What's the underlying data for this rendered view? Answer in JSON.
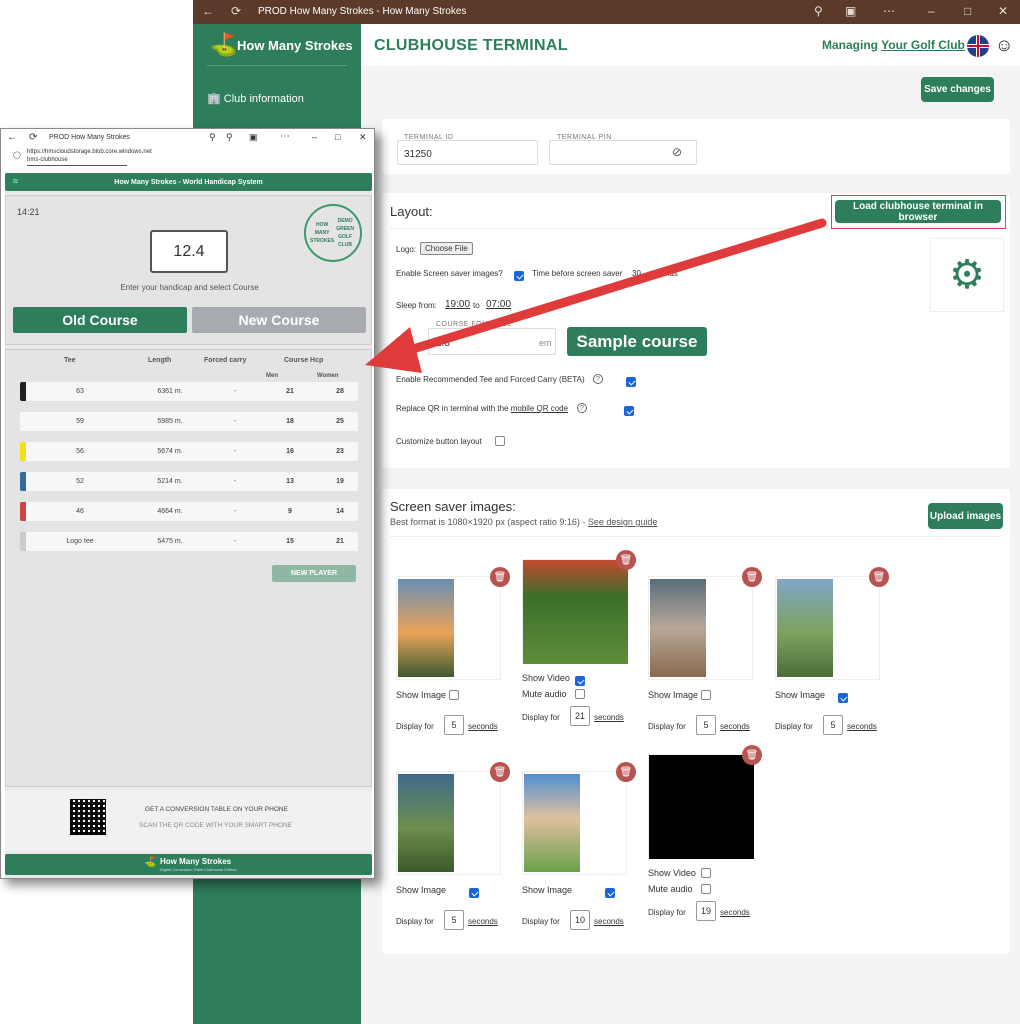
{
  "window": {
    "title": "PROD How Many Strokes - How Many Strokes"
  },
  "sidebar": {
    "brand": "How Many Strokes",
    "items": [
      {
        "label": "Club information"
      }
    ]
  },
  "header": {
    "title": "CLUBHOUSE TERMINAL",
    "managing_prefix": "Managing ",
    "club_name": "Your Golf Club"
  },
  "toolbar": {
    "save_label": "Save changes"
  },
  "terminal": {
    "id_label": "TERMINAL ID",
    "id_value": "31250",
    "pin_label": "TERMINAL PIN"
  },
  "layout": {
    "title": "Layout:",
    "load_button": "Load clubhouse terminal in browser",
    "logo_label": "Logo:",
    "choose_file": "Choose File",
    "screen_saver_label": "Enable Screen saver images?",
    "time_before_label": "Time before screen saver",
    "time_before_value": "30",
    "time_before_unit": "seconds",
    "sleep_from_label": "Sleep from:",
    "sleep_from": "19:00",
    "sleep_to_label": "to",
    "sleep_to": "07:00",
    "font_size_label": "COURSE FONT SIZE",
    "font_size_value": "1.8",
    "font_size_unit": "em",
    "recommended_label": "Enable Recommended Tee and Forced Carry (BETA)",
    "replace_qr_prefix": "Replace QR in terminal with the ",
    "replace_qr_link": "mobile QR code",
    "customize_label": "Customize button layout",
    "sample_badge": "Sample course"
  },
  "screensaver": {
    "title": "Screen saver images:",
    "subtitle": "Best format is 1080×1920 px (aspect ratio 9:16) - ",
    "guide_link": "See design guide",
    "upload_button": "Upload images",
    "display_for": "Display for",
    "seconds": "seconds",
    "show_image": "Show Image",
    "show_video": "Show Video",
    "mute_audio": "Mute audio",
    "items": [
      {
        "kind": "image",
        "show": false,
        "seconds": "5"
      },
      {
        "kind": "video",
        "show": true,
        "mute": false,
        "seconds": "21"
      },
      {
        "kind": "image",
        "show": false,
        "seconds": "5"
      },
      {
        "kind": "image",
        "show": true,
        "seconds": "5"
      },
      {
        "kind": "image",
        "show": true,
        "seconds": "5"
      },
      {
        "kind": "image",
        "show": true,
        "seconds": "10"
      },
      {
        "kind": "video",
        "show": false,
        "mute": false,
        "seconds": "19"
      }
    ]
  },
  "overlay": {
    "title": "PROD How Many Strokes",
    "url1": "https://hmscloudstorage.blob.core.windows.net",
    "url2": "hms-clubhouse",
    "app_title": "How Many Strokes - World Handicap System",
    "time": "14:21",
    "handicap": "12.4",
    "prompt": "Enter your handicap and select Course",
    "old_course": "Old Course",
    "new_course": "New Course",
    "headers": {
      "tee": "Tee",
      "length": "Length",
      "forced": "Forced carry",
      "hcp": "Course Hcp",
      "men": "Men",
      "women": "Women"
    },
    "rows": [
      {
        "tee": "63",
        "length": "6361 m.",
        "forced": "-",
        "men": "21",
        "women": "28",
        "color": "#222222"
      },
      {
        "tee": "59",
        "length": "5985 m.",
        "forced": "-",
        "men": "18",
        "women": "25",
        "color": "#f7f7f7"
      },
      {
        "tee": "56",
        "length": "5674 m.",
        "forced": "-",
        "men": "16",
        "women": "23",
        "color": "#f2e11a"
      },
      {
        "tee": "52",
        "length": "5214 m.",
        "forced": "-",
        "men": "13",
        "women": "19",
        "color": "#2f6d9b"
      },
      {
        "tee": "46",
        "length": "4664 m.",
        "forced": "-",
        "men": "9",
        "women": "14",
        "color": "#c9453d"
      },
      {
        "tee": "Logo tee",
        "length": "5475 m.",
        "forced": "-",
        "men": "15",
        "women": "21",
        "color": "#cccccc"
      }
    ],
    "new_player": "NEW PLAYER",
    "qr_title": "GET A CONVERSION TABLE ON YOUR PHONE",
    "qr_sub": "SCAN THE QR CODE WITH YOUR SMART PHONE",
    "footer_brand": "How Many Strokes",
    "footer_sub": "Digital Conversion Table Clubhouse Edition",
    "seal_text": "HOW MANY STROKES",
    "seal_sub": "DEMO GREEN GOLF CLUB"
  },
  "colors": {
    "brand": "#2e7d5b",
    "title_bar": "#5b3a29",
    "arrow": "#e03b3b",
    "trash": "#b85450"
  }
}
